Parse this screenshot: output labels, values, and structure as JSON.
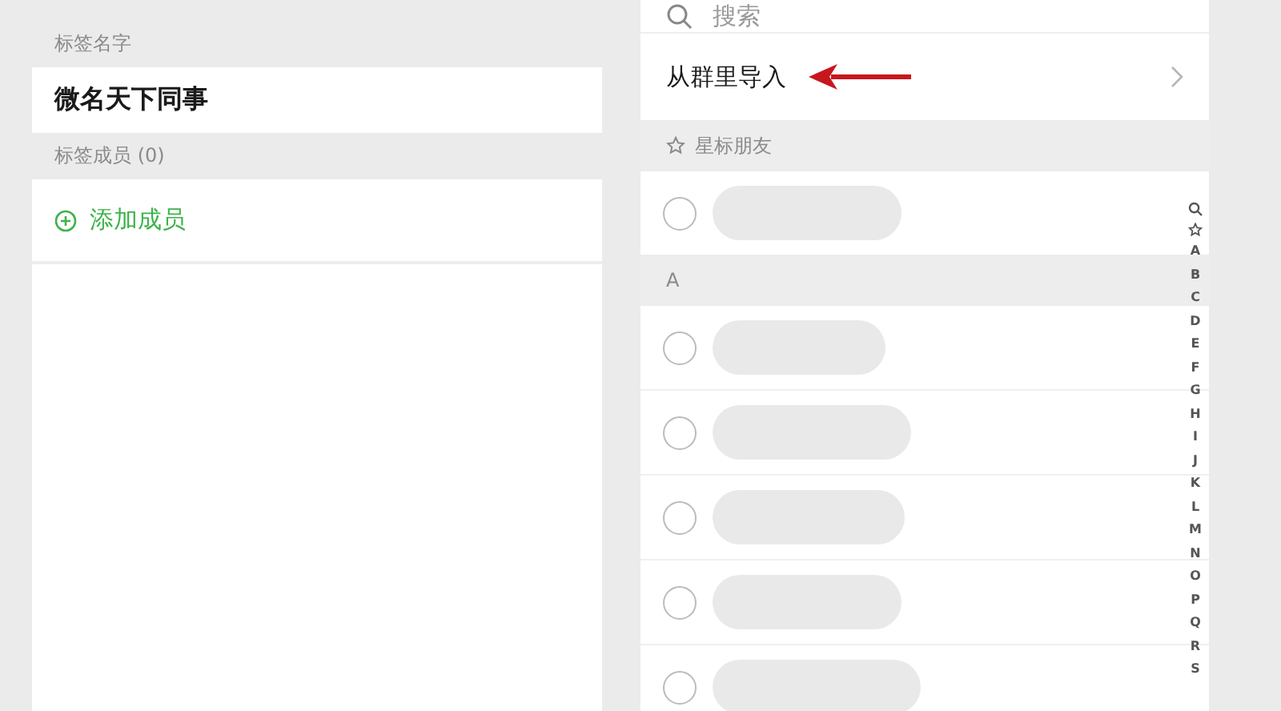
{
  "tag_form": {
    "name_label": "标签名字",
    "name_value": "微名天下同事",
    "members_label": "标签成员 (0)",
    "add_member": "添加成员"
  },
  "picker": {
    "search": {
      "placeholder": "搜索"
    },
    "import_row": {
      "label": "从群里导入"
    },
    "sections": [
      {
        "kind": "starred",
        "title": "星标朋友",
        "contacts": [
          {
            "selected": false
          }
        ]
      },
      {
        "kind": "letter",
        "title": "A",
        "contacts": [
          {
            "selected": false
          },
          {
            "selected": false
          },
          {
            "selected": false
          },
          {
            "selected": false
          },
          {
            "selected": false
          }
        ]
      }
    ],
    "index": [
      "A",
      "B",
      "C",
      "D",
      "E",
      "F",
      "G",
      "H",
      "I",
      "J",
      "K",
      "L",
      "M",
      "N",
      "O",
      "P",
      "Q",
      "R",
      "S"
    ]
  }
}
